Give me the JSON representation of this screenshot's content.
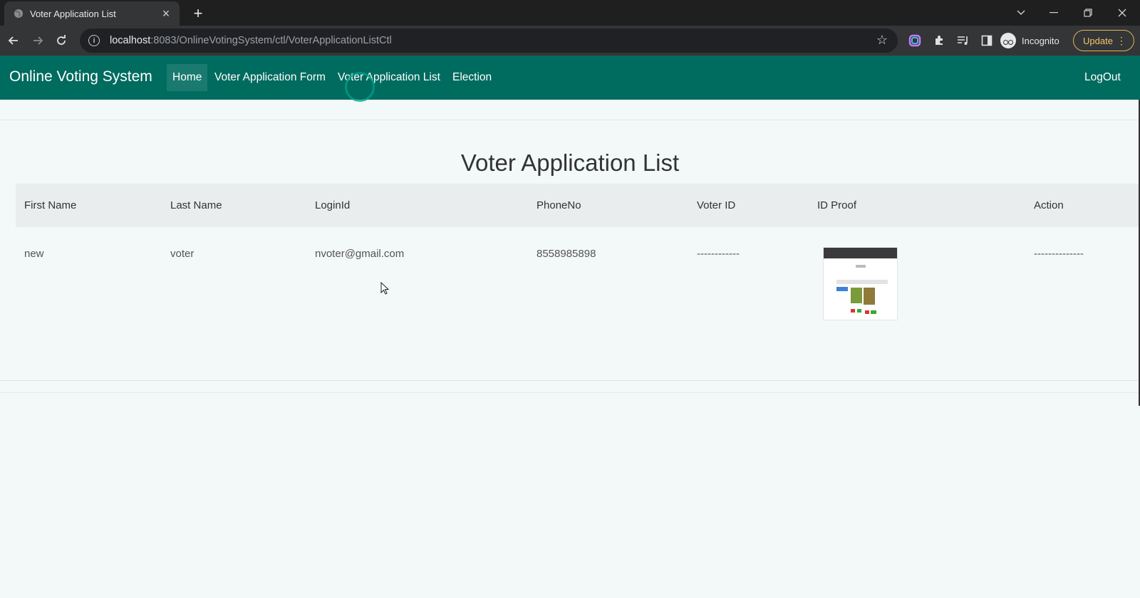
{
  "browser": {
    "tab_title": "Voter Application List",
    "url_host": "localhost",
    "url_rest": ":8083/OnlineVotingSystem/ctl/VoterApplicationListCtl",
    "profile_label": "Incognito",
    "update_label": "Update",
    "icons": [
      "globe-icon",
      "close-icon",
      "plus-icon",
      "chevron-down-icon",
      "minimize-icon",
      "restore-icon",
      "window-close-icon",
      "back-icon",
      "forward-icon",
      "reload-icon",
      "info-icon",
      "star-icon",
      "color-ext-icon",
      "puzzle-icon",
      "media-icon",
      "sidepanel-icon",
      "incognito-icon",
      "more-icon"
    ]
  },
  "app": {
    "brand": "Online Voting System",
    "nav": [
      {
        "label": "Home",
        "active": true
      },
      {
        "label": "Voter Application Form",
        "active": false
      },
      {
        "label": "Voter Application List",
        "active": false
      },
      {
        "label": "Election",
        "active": false
      }
    ],
    "logout": "LogOut",
    "accent": "#006b5f"
  },
  "page": {
    "title": "Voter Application List",
    "columns": [
      "First Name",
      "Last Name",
      "LoginId",
      "PhoneNo",
      "Voter ID",
      "ID Proof",
      "Action"
    ],
    "rows": [
      {
        "first_name": "new",
        "last_name": "voter",
        "login_id": "nvoter@gmail.com",
        "phone": "8558985898",
        "voter_id": "------------",
        "id_proof": "thumbnail",
        "action": "--------------"
      }
    ]
  }
}
